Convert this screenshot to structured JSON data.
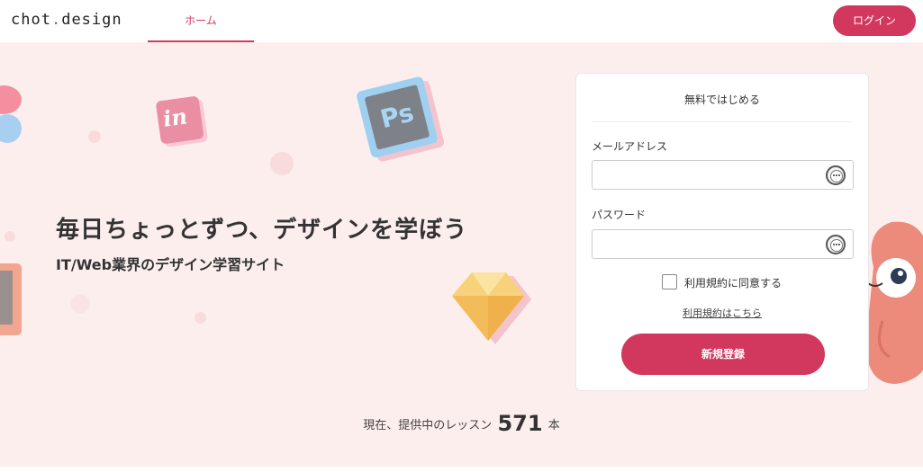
{
  "header": {
    "logo_left": "chot",
    "logo_dot": ".",
    "logo_right": "design",
    "nav_home": "ホーム",
    "login_label": "ログイン"
  },
  "hero": {
    "headline": "毎日ちょっとずつ、デザインを学ぼう",
    "subheadline": "IT/Web業界のデザイン学習サイト",
    "icon_ps": "Ps",
    "icon_in": "in"
  },
  "signup": {
    "title": "無料ではじめる",
    "email_label": "メールアドレス",
    "email_value": "",
    "password_label": "パスワード",
    "password_value": "",
    "agree_label": "利用規約に同意する",
    "terms_link": "利用規約はこちら",
    "submit_label": "新規登録"
  },
  "footer": {
    "lesson_prefix": "現在、提供中のレッスン",
    "lesson_count": "571",
    "lesson_suffix": "本"
  },
  "colors": {
    "accent": "#d2375d",
    "hero_bg": "#fdeeee"
  }
}
